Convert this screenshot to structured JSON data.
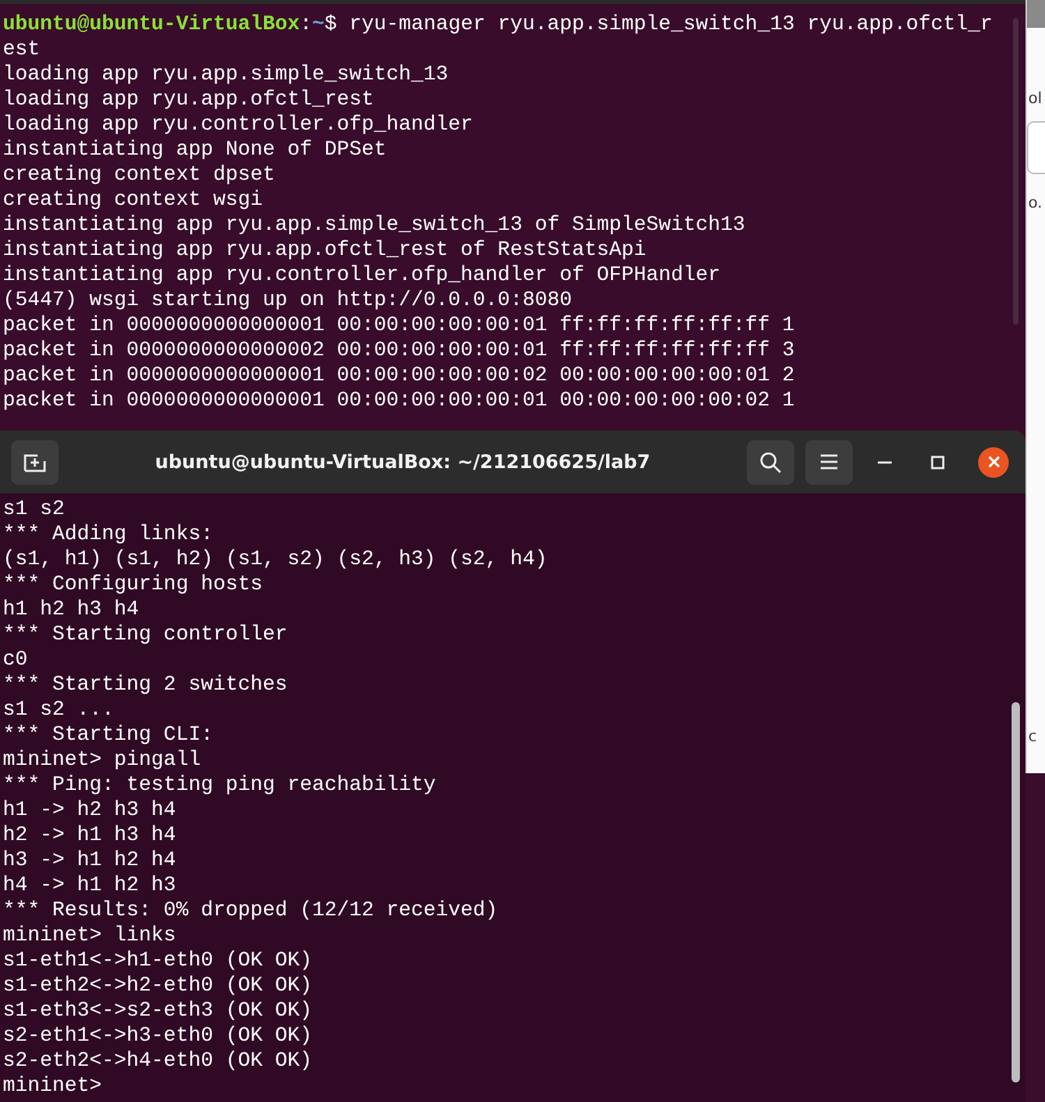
{
  "back_terminal": {
    "prompt": {
      "user_host": "ubuntu@ubuntu-VirtualBox",
      "separator": ":",
      "path": "~",
      "command": "$ ryu-manager ryu.app.simple_switch_13 ryu.app.ofctl_r"
    },
    "lines": [
      "est",
      "loading app ryu.app.simple_switch_13",
      "loading app ryu.app.ofctl_rest",
      "loading app ryu.controller.ofp_handler",
      "instantiating app None of DPSet",
      "creating context dpset",
      "creating context wsgi",
      "instantiating app ryu.app.simple_switch_13 of SimpleSwitch13",
      "instantiating app ryu.app.ofctl_rest of RestStatsApi",
      "instantiating app ryu.controller.ofp_handler of OFPHandler",
      "(5447) wsgi starting up on http://0.0.0.0:8080",
      "packet in 0000000000000001 00:00:00:00:00:01 ff:ff:ff:ff:ff:ff 1",
      "packet in 0000000000000002 00:00:00:00:00:01 ff:ff:ff:ff:ff:ff 3",
      "packet in 0000000000000001 00:00:00:00:00:02 00:00:00:00:00:01 2",
      "packet in 0000000000000001 00:00:00:00:00:01 00:00:00:00:00:02 1"
    ]
  },
  "side_window": {
    "fragments": [
      "ol",
      "o.",
      "c"
    ]
  },
  "front_terminal": {
    "title": "ubuntu@ubuntu-VirtualBox: ~/212106625/lab7",
    "lines": [
      "s1 s2",
      "*** Adding links:",
      "(s1, h1) (s1, h2) (s1, s2) (s2, h3) (s2, h4)",
      "*** Configuring hosts",
      "h1 h2 h3 h4",
      "*** Starting controller",
      "c0",
      "*** Starting 2 switches",
      "s1 s2 ...",
      "*** Starting CLI:",
      "mininet> pingall",
      "*** Ping: testing ping reachability",
      "h1 -> h2 h3 h4",
      "h2 -> h1 h3 h4",
      "h3 -> h1 h2 h4",
      "h4 -> h1 h2 h3",
      "*** Results: 0% dropped (12/12 received)",
      "mininet> links",
      "s1-eth1<->h1-eth0 (OK OK)",
      "s1-eth2<->h2-eth0 (OK OK)",
      "s1-eth3<->s2-eth3 (OK OK)",
      "s2-eth1<->h3-eth0 (OK OK)",
      "s2-eth2<->h4-eth0 (OK OK)",
      "mininet>"
    ]
  }
}
